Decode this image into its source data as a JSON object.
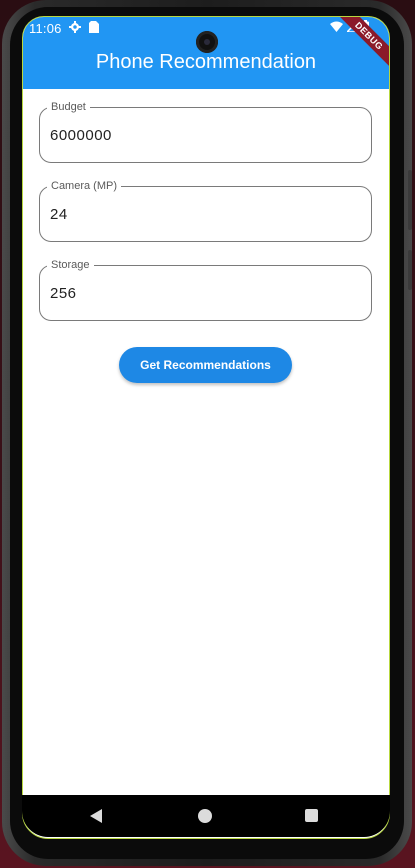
{
  "status_bar": {
    "time": "11:06",
    "left_icons": [
      "settings-icon",
      "sim-card-icon"
    ],
    "right_icons": [
      "wifi-icon",
      "signal-icon",
      "battery-icon"
    ]
  },
  "debug_banner": "DEBUG",
  "app_bar": {
    "title": "Phone Recommendation",
    "color": "#2196f3"
  },
  "form": {
    "fields": [
      {
        "label": "Budget",
        "value": "6000000"
      },
      {
        "label": "Camera (MP)",
        "value": "24"
      },
      {
        "label": "Storage",
        "value": "256"
      }
    ],
    "submit_label": "Get Recommendations",
    "button_color": "#1e88e5"
  },
  "nav_bar": {
    "buttons": [
      "back-icon",
      "home-icon",
      "recent-apps-icon"
    ]
  }
}
